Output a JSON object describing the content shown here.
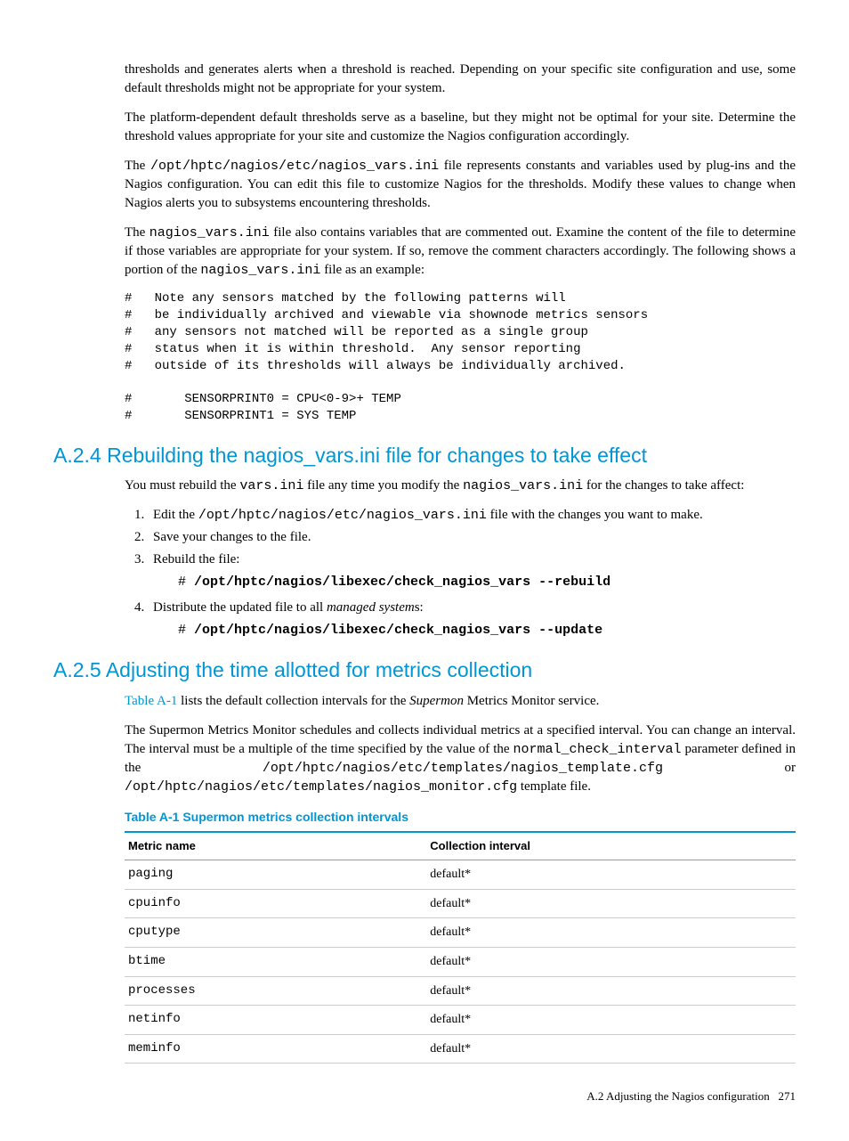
{
  "p1": "thresholds and generates alerts when a threshold is reached. Depending on your specific site configuration and use, some default thresholds might not be appropriate for your system.",
  "p2": "The platform-dependent default thresholds serve as a baseline, but they might not be optimal for your site. Determine the threshold values appropriate for your site and customize the Nagios configuration accordingly.",
  "p3a": "The ",
  "p3code": "/opt/hptc/nagios/etc/nagios_vars.ini",
  "p3b": " file represents constants and variables used by plug-ins and the Nagios configuration. You can edit this file to customize Nagios for the thresholds. Modify these values to change when Nagios alerts you to subsystems encountering thresholds.",
  "p4a": "The ",
  "p4code": "nagios_vars.ini",
  "p4b": " file also contains variables that are commented out. Examine the content of the file to determine if those variables are appropriate for your system. If so, remove the comment characters accordingly. The following shows a portion of the ",
  "p4code2": "nagios_vars.ini",
  "p4c": " file as an example:",
  "codeblock1": "#   Note any sensors matched by the following patterns will\n#   be individually archived and viewable via shownode metrics sensors\n#   any sensors not matched will be reported as a single group\n#   status when it is within threshold.  Any sensor reporting\n#   outside of its thresholds will always be individually archived.\n\n#       SENSORPRINT0 = CPU<0-9>+ TEMP\n#       SENSORPRINT1 = SYS TEMP",
  "h_a24": "A.2.4 Rebuilding the nagios_vars.ini file for changes to take effect",
  "p5a": "You must rebuild the ",
  "p5code1": "vars.ini",
  "p5b": " file any time you modify the ",
  "p5code2": "nagios_vars.ini",
  "p5c": " for the changes to take affect:",
  "li1a": "Edit the ",
  "li1code": "/opt/hptc/nagios/etc/nagios_vars.ini",
  "li1b": " file with the changes you want to make.",
  "li2": "Save your changes to the file.",
  "li3": "Rebuild the file:",
  "cmd3prompt": "# ",
  "cmd3": "/opt/hptc/nagios/libexec/check_nagios_vars --rebuild",
  "li4a": "Distribute the updated file to all ",
  "li4italic": "managed system",
  "li4b": "s:",
  "cmd4prompt": "# ",
  "cmd4": "/opt/hptc/nagios/libexec/check_nagios_vars --update",
  "h_a25": "A.2.5 Adjusting the time allotted for metrics collection",
  "p6link": "Table A-1",
  "p6a": " lists the default collection intervals for the ",
  "p6italic": "Supermon",
  "p6b": " Metrics Monitor service.",
  "p7a": "The Supermon Metrics Monitor schedules and collects individual metrics at a specified interval. You can change an interval. The interval must be a multiple of the time specified by the value of the ",
  "p7code1": "normal_check_interval",
  "p7b": " parameter defined in the ",
  "p7code2": "/opt/hptc/nagios/etc/templates/nagios_template.cfg",
  "p7c": " or ",
  "p7code3": "/opt/hptc/nagios/etc/templates/nagios_monitor.cfg",
  "p7d": " template file.",
  "tablecap": "Table A-1 Supermon metrics collection intervals",
  "th1": "Metric name",
  "th2": "Collection interval",
  "rows": [
    {
      "metric": "paging",
      "interval": "default*"
    },
    {
      "metric": "cpuinfo",
      "interval": "default*"
    },
    {
      "metric": "cputype",
      "interval": "default*"
    },
    {
      "metric": "btime",
      "interval": "default*"
    },
    {
      "metric": "processes",
      "interval": "default*"
    },
    {
      "metric": "netinfo",
      "interval": "default*"
    },
    {
      "metric": "meminfo",
      "interval": "default*"
    }
  ],
  "footer_text": "A.2 Adjusting the Nagios configuration",
  "footer_page": "271"
}
